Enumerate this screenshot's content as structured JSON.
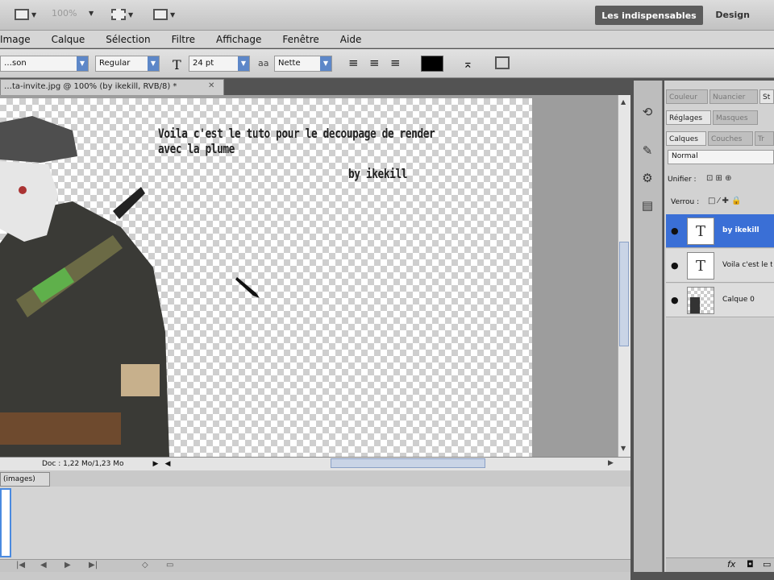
{
  "appbar": {
    "zoom": "100%",
    "workspace": "Les indispensables",
    "design": "Design"
  },
  "menu": [
    "Image",
    "Calque",
    "Sélection",
    "Filtre",
    "Affichage",
    "Fenêtre",
    "Aide"
  ],
  "options": {
    "font_family": "…son",
    "font_style": "Regular",
    "font_size": "24 pt",
    "antialias": "Nette"
  },
  "document": {
    "tab_title": "…ta-invite.jpg @ 100% (by ikekill, RVB/8) *",
    "status": "Doc : 1,22 Mo/1,23 Mo"
  },
  "canvas": {
    "text_line1": "Voila c'est le tuto pour le decoupage de render avec la plume",
    "text_line2": "by ikekill"
  },
  "lower_panel": {
    "tab": "(images)"
  },
  "right_panel": {
    "tabs": [
      "Couleur",
      "Nuancier",
      "St"
    ],
    "adjust_tabs": [
      "Réglages",
      "Masques"
    ],
    "layers_tabs": [
      "Calques",
      "Couches",
      "Tr"
    ],
    "blend_mode": "Normal",
    "unify_label": "Unifier :",
    "lock_label": "Verrou :",
    "layers": [
      {
        "name": "by ikekill",
        "type": "T",
        "selected": true
      },
      {
        "name": "Voila c'est le t",
        "type": "T",
        "selected": false
      },
      {
        "name": "Calque 0",
        "type": "img",
        "selected": false
      }
    ]
  },
  "colors": {
    "accent": "#3a6fd6",
    "workspace_btn": "#5c5c5c"
  }
}
